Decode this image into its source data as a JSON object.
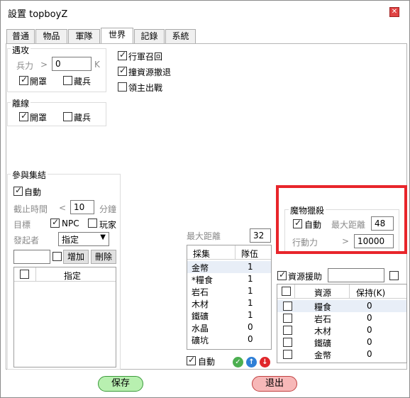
{
  "window": {
    "title": "設置 topboyZ",
    "close_label": "✕"
  },
  "tabs": [
    "普通",
    "物品",
    "軍隊",
    "世界",
    "記錄",
    "系統"
  ],
  "attack": {
    "title": "遇攻",
    "troops_label": "兵力",
    "gt": ">",
    "troops_value": "0",
    "unit": "K",
    "open_label": "開罩",
    "hide_label": "藏兵",
    "open_checked": true,
    "hide_checked": false
  },
  "options": [
    {
      "label": "行軍召回",
      "checked": true
    },
    {
      "label": "撞資源撤退",
      "checked": true
    },
    {
      "label": "領主出戰",
      "checked": false
    }
  ],
  "offline": {
    "title": "離線",
    "open_label": "開罩",
    "hide_label": "藏兵",
    "open_checked": true,
    "hide_checked": false
  },
  "rally": {
    "title": "參與集結",
    "auto_label": "自動",
    "auto_checked": true,
    "deadline_label": "截止時間",
    "lt": "<",
    "deadline_value": "10",
    "minutes": "分鐘",
    "target_label": "目標",
    "npc_label": "NPC",
    "npc_checked": true,
    "player_label": "玩家",
    "player_checked": false,
    "initiator_label": "發起者",
    "initiator_value": "指定",
    "add_label": "增加",
    "delete_label": "刪除",
    "list_header": "指定"
  },
  "gather": {
    "max_distance_label": "最大距離",
    "max_distance_value": "32",
    "col_gather": "採集",
    "col_queue": "隊伍",
    "rows": [
      {
        "name": "金幣",
        "value": "1"
      },
      {
        "name": "*糧食",
        "value": "1"
      },
      {
        "name": "岩石",
        "value": "1"
      },
      {
        "name": "木材",
        "value": "1"
      },
      {
        "name": "鐵礦",
        "value": "1"
      },
      {
        "name": "水晶",
        "value": "0"
      },
      {
        "name": "礦坑",
        "value": "0"
      }
    ],
    "auto_label": "自動",
    "auto_checked": true
  },
  "monster": {
    "title": "魔物獵殺",
    "auto_label": "自動",
    "auto_checked": true,
    "max_distance_label": "最大距離",
    "max_distance_value": "48",
    "action_label": "行動力",
    "gt": ">",
    "action_value": "10000"
  },
  "resource_aid": {
    "label": "資源援助",
    "checked": true,
    "col_resource": "資源",
    "col_keep": "保持(K)",
    "rows": [
      {
        "name": "糧食",
        "value": "0"
      },
      {
        "name": "岩石",
        "value": "0"
      },
      {
        "name": "木材",
        "value": "0"
      },
      {
        "name": "鐵礦",
        "value": "0"
      },
      {
        "name": "金幣",
        "value": "0"
      }
    ]
  },
  "footer": {
    "save_label": "保存",
    "exit_label": "退出"
  },
  "colors": {
    "highlight": "#e8252b",
    "save_bg": "#b8f0b0",
    "exit_bg": "#f7b8b8"
  }
}
